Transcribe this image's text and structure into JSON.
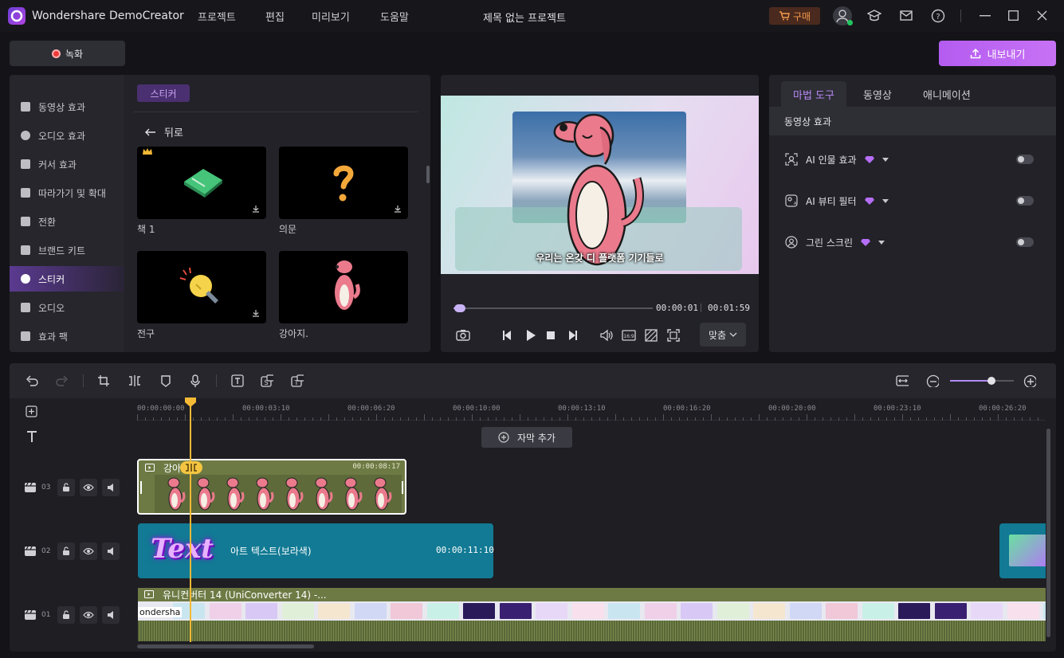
{
  "app": {
    "name": "Wondershare DemoCreator",
    "project_title": "제목 없는 프로젝트"
  },
  "menu": [
    "프로젝트",
    "편집",
    "미리보기",
    "도움말"
  ],
  "titlebar": {
    "buy_label": "구매"
  },
  "toolbar": {
    "record_label": "녹화",
    "export_label": "내보내기"
  },
  "sidebar": {
    "items": [
      {
        "label": "동영상 효과",
        "icon": "film-effect-icon"
      },
      {
        "label": "오디오 효과",
        "icon": "music-note-icon"
      },
      {
        "label": "커서 효과",
        "icon": "cursor-icon"
      },
      {
        "label": "따라가기 및 확대",
        "icon": "zoom-icon"
      },
      {
        "label": "전환",
        "icon": "transition-icon"
      },
      {
        "label": "브랜드 키트",
        "icon": "brand-icon"
      },
      {
        "label": "스티커",
        "icon": "sticker-icon",
        "active": true
      },
      {
        "label": "오디오",
        "icon": "music-icon"
      },
      {
        "label": "효과 팩",
        "icon": "store-icon"
      }
    ]
  },
  "library": {
    "tab": "스티커",
    "back_label": "뒤로",
    "items": [
      {
        "label": "책 1",
        "icon": "book-icon"
      },
      {
        "label": "의문",
        "icon": "question-icon"
      },
      {
        "label": "전구",
        "icon": "lightbulb-icon"
      },
      {
        "label": "강아지.",
        "icon": "dog-icon"
      }
    ]
  },
  "preview": {
    "caption": "우리는 온갖 디  플랫폼 기기들로",
    "current_time": "00:00:01",
    "total_time": "00:01:59",
    "progress": 0.01,
    "fit_label": "맞춤"
  },
  "right_panel": {
    "tabs": [
      "마법 도구",
      "동영상",
      "애니메이션"
    ],
    "section_title": "동영상 효과",
    "rows": [
      {
        "label": "AI 인물 효과",
        "enabled": false
      },
      {
        "label": "AI 뷰티 필터",
        "enabled": false
      },
      {
        "label": "그린 스크린",
        "enabled": false
      }
    ]
  },
  "timeline": {
    "ruler": [
      "00:00:00:00",
      "00:00:03:10",
      "00:00:06:20",
      "00:00:10:00",
      "00:00:13:10",
      "00:00:16:20",
      "00:00:20:00",
      "00:00:23:10",
      "00:00:26:20"
    ],
    "add_subtitle_label": "자막 추가",
    "zoom_level": 0.65,
    "tracks": [
      {
        "num": "03",
        "clip_title": "강아",
        "clip_duration": "00:00:08:17"
      },
      {
        "num": "02",
        "clip_title": "아트 텍스트(보라색)",
        "clip_duration": "00:00:11:10",
        "art_text": "Text"
      },
      {
        "num": "01",
        "clip_title": "유니컨버터 14 (UniConverter 14) -...",
        "thumb_text": "ondersha"
      }
    ]
  },
  "colors": {
    "accent": "#a855f7",
    "playhead": "#f5b935",
    "clip_teal": "#127a94",
    "clip_olive": "#6d7a44"
  }
}
